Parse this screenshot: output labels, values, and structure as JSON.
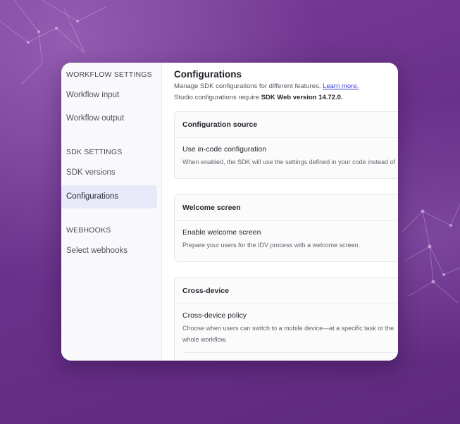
{
  "sidebar": {
    "sections": [
      {
        "heading": "WORKFLOW SETTINGS",
        "items": [
          {
            "label": "Workflow input"
          },
          {
            "label": "Workflow output"
          }
        ]
      },
      {
        "heading": "SDK SETTINGS",
        "items": [
          {
            "label": "SDK versions"
          },
          {
            "label": "Configurations"
          }
        ]
      },
      {
        "heading": "WEBHOOKS",
        "items": [
          {
            "label": "Select webhooks"
          }
        ]
      }
    ],
    "active_item": "Configurations"
  },
  "main": {
    "title": "Configurations",
    "description": "Manage SDK configurations for different features.",
    "learn_more": "Learn more.",
    "requirement_prefix": "Studio configurations require",
    "requirement_version": "SDK Web version 14.72.0.",
    "cards": [
      {
        "title": "Configuration source",
        "option_title": "Use in-code configuration",
        "option_desc_1": "When enabled, the SDK will use the settings defined in your code instead of",
        "option_desc_2": ""
      },
      {
        "title": "Welcome screen",
        "option_title": "Enable welcome screen",
        "option_desc_1": "Prepare your users for the IDV process with a welcome screen.",
        "option_desc_2": ""
      },
      {
        "title": "Cross-device",
        "option_title": "Cross-device policy",
        "option_desc_1": "Choose when users can switch to a mobile device—at a specific task or the",
        "option_desc_2": "whole workflow."
      }
    ]
  },
  "colors": {
    "background": "#662f86",
    "accent": "#3a3fe0",
    "active_item_bg": "#e8e9f9"
  }
}
